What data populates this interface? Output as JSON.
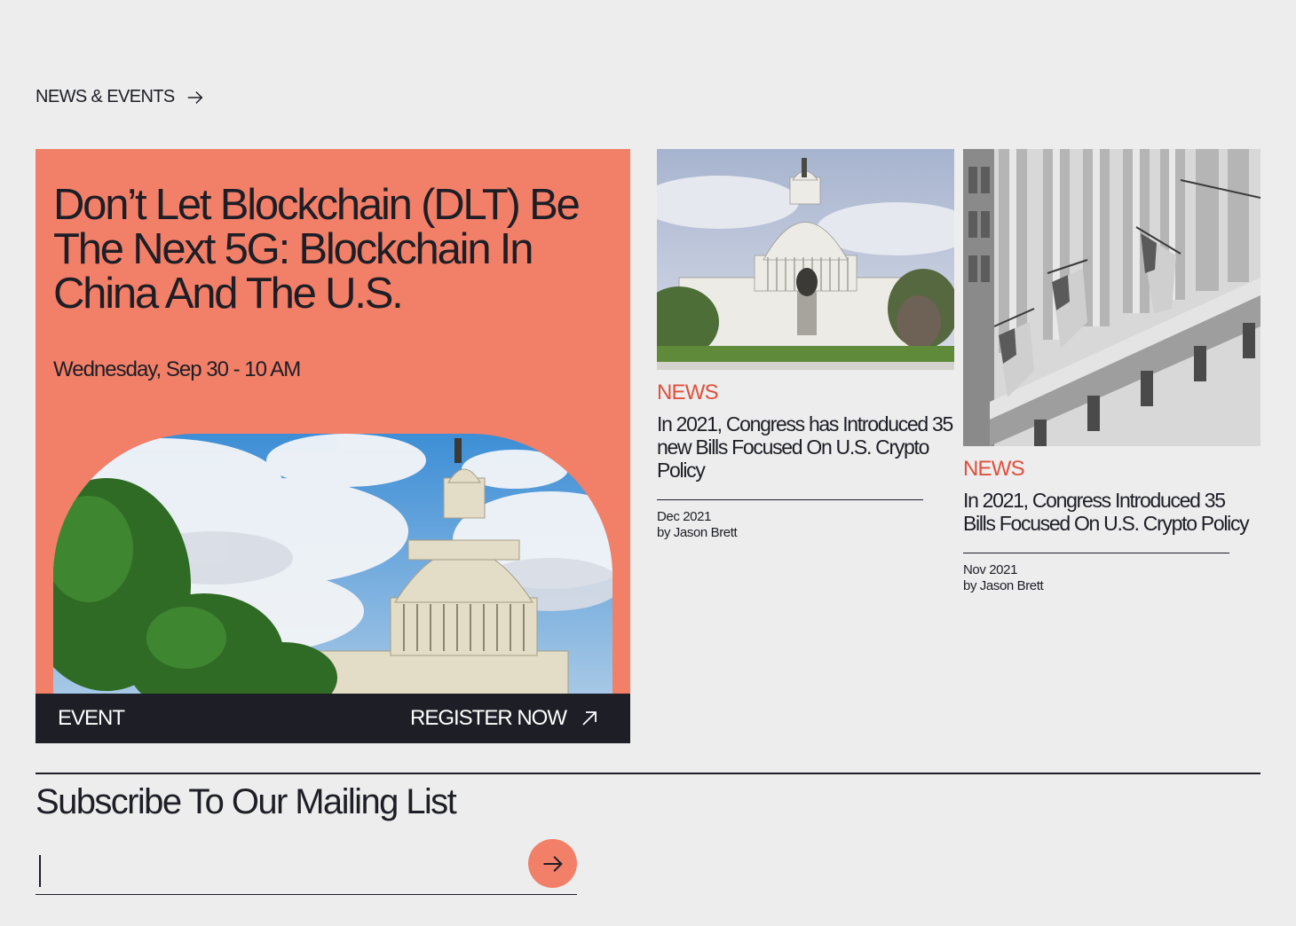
{
  "section": {
    "label": "NEWS & EVENTS"
  },
  "event": {
    "title": "Don’t Let Blockchain (DLT) Be The Next 5G: Blockchain In China And The U.S.",
    "date": "Wednesday, Sep 30 - 10 AM",
    "type_label": "EVENT",
    "register_label": "REGISTER NOW",
    "accent_color": "#f27f68",
    "footer_color": "#1d1e26"
  },
  "news": [
    {
      "tag": "NEWS",
      "title": "In 2021, Congress has Introduced 35 new Bills Focused On U.S. Crypto Policy",
      "date": "Dec 2021",
      "author": "by Jason Brett",
      "image": "capitol-building-photo"
    },
    {
      "tag": "NEWS",
      "title": "In 2021, Congress Introduced 35 Bills Focused On U.S. Crypto Policy",
      "date": "Nov 2021",
      "author": "by Jason Brett",
      "image": "nyse-building-bw-photo"
    }
  ],
  "subscribe": {
    "title": "Subscribe To Our Mailing List",
    "input_value": "",
    "input_placeholder": "",
    "submit_icon": "arrow-right-icon"
  },
  "colors": {
    "tag": "#e0503d",
    "background": "#ededed",
    "text": "#1d1e26"
  }
}
